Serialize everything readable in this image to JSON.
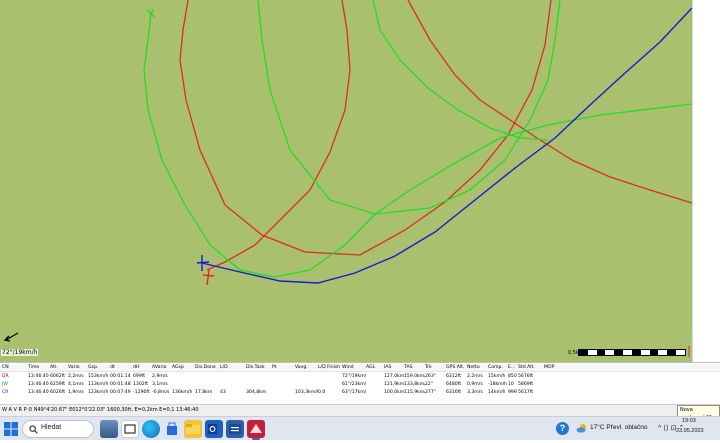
{
  "map": {
    "background_color": "#a9c16f",
    "wind_label": "72°/19km/h",
    "scale_label": "0.5km",
    "track_colors": {
      "red": "#e22828",
      "green": "#22dd22",
      "blue": "#1a1ad0"
    }
  },
  "flight_table": {
    "headers": [
      "CN",
      "Time",
      "Alt.",
      "Vario",
      "Gsp.",
      "dt",
      "dH",
      "AVario",
      "AGsp",
      "Dis.Done",
      "L/D",
      "Dis.Task",
      "Pt",
      "Vavg.",
      "L/D Finish",
      "Wind",
      "AGL",
      "IAS",
      "TAS",
      "Trk",
      "GPS Alt.",
      "Netto",
      "Comp.",
      "E...",
      "Std.Alt.",
      "MOP"
    ],
    "rows": [
      {
        "cn": "DR",
        "color": "#c00000",
        "cells": [
          "DR",
          "13:46:40",
          "6062ft",
          "2,2m/s",
          "153km/h",
          "00:01:14",
          "699ft",
          "2,9m/s",
          "",
          "",
          "",
          "",
          "",
          "",
          "",
          "72°/19km/h/+4454ft",
          "",
          "127,0km/h",
          "159,0km/h",
          "263°",
          "6312ft",
          "2,2m/s",
          "15km/h",
          "850",
          "5676ft",
          ""
        ]
      },
      {
        "cn": "JW",
        "color": "#14a014",
        "cells": [
          "JW",
          "13:46:40",
          "6259ft",
          "4,1m/s",
          "113km/h",
          "00:01:48",
          "1302ft",
          "3,1m/s",
          "",
          "",
          "",
          "",
          "",
          "",
          "",
          "61°/23km/h/+4652ft",
          "",
          "121,9km/h",
          "133,8km/h",
          "22°",
          "6480ft",
          "0,9m/s",
          "-18km/h",
          "10",
          "5869ft",
          ""
        ]
      },
      {
        "cn": "CR",
        "color": "#1a1ad0",
        "cells": [
          "CR",
          "13:46:40",
          "6026ft",
          "1,9m/s",
          "123km/h",
          "00:07:49",
          "-1296ft",
          "-0,8m/s",
          "136km/h",
          "17,8km",
          "43",
          "304,8km",
          "",
          "103,3km/h",
          "0.0",
          "63°/17km/h/+4418ft",
          "",
          "100,0km/h",
          "115,9km/h",
          "277°",
          "6316ft",
          "3,3m/s",
          "14km/h",
          "999",
          "5617ft",
          ""
        ]
      }
    ]
  },
  "status_bar": {
    "text": "W  A  V  R  P  ⏱ N49°4'20.67\"  E012°0'22.03\"  1600,30ft, E=0,2km E=0,1   13:46:40",
    "tooltip": "Nova oznámení 21"
  },
  "taskbar": {
    "search_placeholder": "Hledat",
    "weather": "17°C  Převl. oblačno",
    "tray_icons": "^  ⟨⟩  ⊡  ⌃",
    "time": "19:03",
    "date": "23.05.2023"
  }
}
